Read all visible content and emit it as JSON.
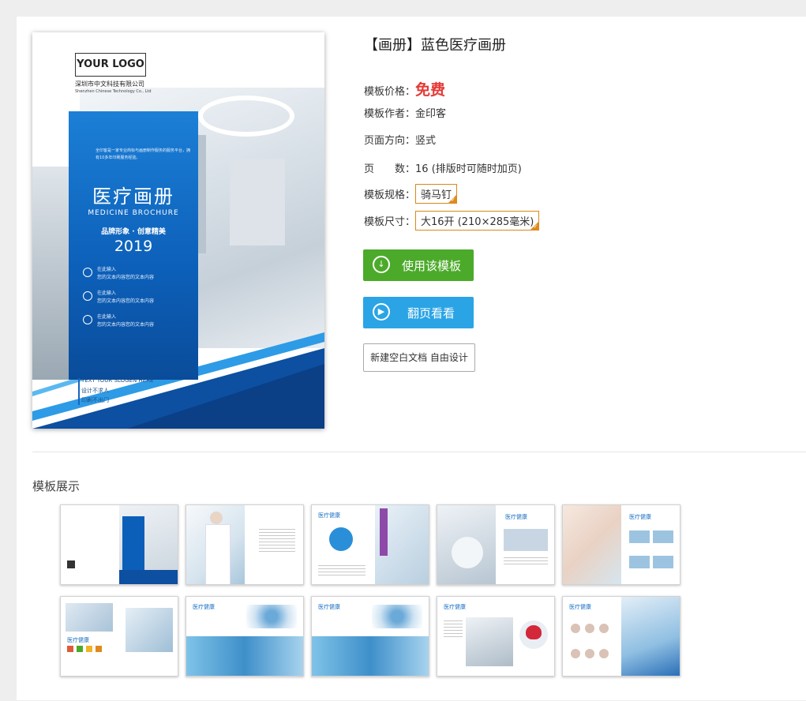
{
  "product": {
    "title": "【画册】蓝色医疗画册",
    "price_label": "模板价格：",
    "price_value": "免费",
    "author_label": "模板作者：",
    "author_value": "金印客",
    "orientation_label": "页面方向：",
    "orientation_value": "竖式",
    "pages_label": "页　　数：",
    "pages_value": "16 (排版时可随时加页)",
    "spec_label": "模板规格：",
    "spec_value": "骑马钉",
    "size_label": "模板尺寸：",
    "size_value": "大16开 (210×285毫米)"
  },
  "buttons": {
    "use_label": "使用该模板",
    "flip_label": "翻页看看",
    "new_label": "新建空白文档 自由设计"
  },
  "cover": {
    "logo_text": "YOUR  LOGO",
    "company_cn": "深圳市中文科技有限公司",
    "company_en": "Shenzhen Chinese Technology Co., Ltd",
    "intro": "全印客是一家专业商标与画册制作服务的服务平台，拥有10多年印刷服务经验。",
    "title_cn": "医疗画册",
    "title_en": "MEDICINE BROCHURE",
    "slogan": "品牌形象 · 创意精美",
    "year": "2019",
    "items": [
      {
        "head": "在此输入",
        "body": "您的文本内容您的文本内容"
      },
      {
        "head": "在此输入",
        "body": "您的文本内容您的文本内容"
      },
      {
        "head": "在此输入",
        "body": "您的文本内容您的文本内容"
      }
    ],
    "bottom_slogan": "TEXT YOUR SLOGEN HERE",
    "bottom_line1": "设计不求人",
    "bottom_line2": "印刷不出门"
  },
  "showcase": {
    "heading": "模板展示",
    "thumb_title": "医疗健康"
  },
  "colors": {
    "accent_green": "#4caa2a",
    "accent_blue": "#2ba4e6",
    "price_red": "#e53935",
    "spec_border": "#d9881a",
    "cover_blue": "#0c5fb8"
  }
}
